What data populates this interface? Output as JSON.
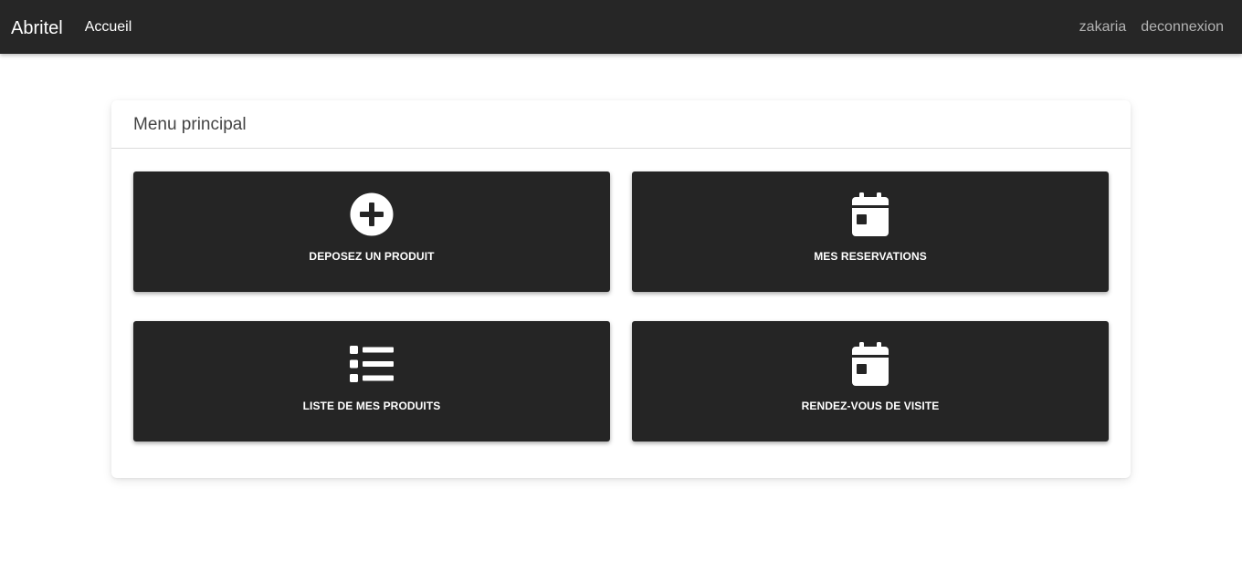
{
  "navbar": {
    "brand": "Abritel",
    "home_link": "Accueil",
    "user_name": "zakaria",
    "logout_link": "deconnexion"
  },
  "main_menu": {
    "title": "Menu principal",
    "tiles": [
      {
        "label": "DEPOSEZ UN PRODUIT",
        "icon": "plus-circle-icon"
      },
      {
        "label": "MES RESERVATIONS",
        "icon": "calendar-icon"
      },
      {
        "label": "LISTE DE MES PRODUITS",
        "icon": "list-icon"
      },
      {
        "label": "RENDEZ-VOUS DE VISITE",
        "icon": "calendar-icon"
      }
    ]
  },
  "colors": {
    "navbar_bg": "#262626",
    "tile_bg": "#252525",
    "nav_muted_text": "#b3b3b3"
  }
}
